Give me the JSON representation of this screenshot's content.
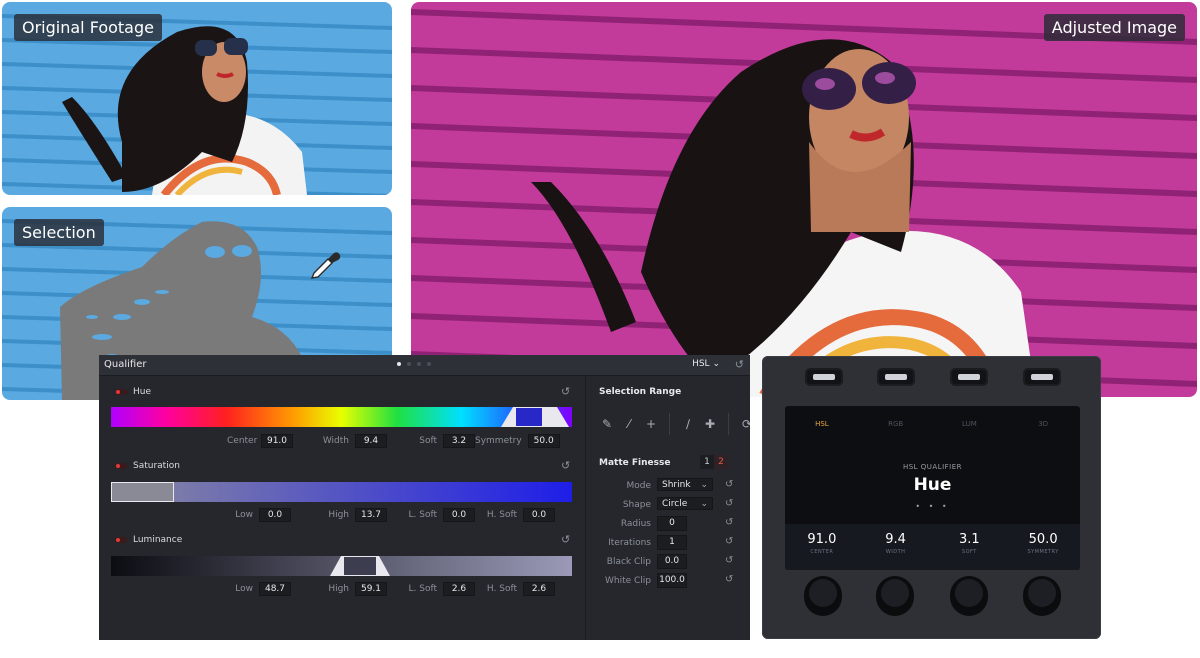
{
  "labels": {
    "original": "Original Footage",
    "selection": "Selection",
    "adjusted": "Adjusted Image"
  },
  "qualifier": {
    "title": "Qualifier",
    "mode": "HSL",
    "mode_chevron_icon": "chevron-down-icon",
    "hue": {
      "label": "Hue",
      "fields": [
        {
          "label": "Center",
          "value": "91.0"
        },
        {
          "label": "Width",
          "value": "9.4"
        },
        {
          "label": "Soft",
          "value": "3.2"
        },
        {
          "label": "Symmetry",
          "value": "50.0"
        }
      ]
    },
    "saturation": {
      "label": "Saturation",
      "fields": [
        {
          "label": "Low",
          "value": "0.0"
        },
        {
          "label": "High",
          "value": "13.7"
        },
        {
          "label": "L. Soft",
          "value": "0.0"
        },
        {
          "label": "H. Soft",
          "value": "0.0"
        }
      ]
    },
    "luminance": {
      "label": "Luminance",
      "fields": [
        {
          "label": "Low",
          "value": "48.7"
        },
        {
          "label": "High",
          "value": "59.1"
        },
        {
          "label": "L. Soft",
          "value": "2.6"
        },
        {
          "label": "H. Soft",
          "value": "2.6"
        }
      ]
    },
    "selection_range": {
      "title": "Selection Range",
      "tools": [
        "eyedropper-icon",
        "pen-icon",
        "pen-add-icon",
        "feather-icon",
        "feather-add-icon",
        "invert-icon"
      ]
    },
    "matte_finesse": {
      "title": "Matte Finesse",
      "pages": [
        "1",
        "2"
      ],
      "rows": [
        {
          "label": "Mode",
          "value": "Shrink",
          "type": "select"
        },
        {
          "label": "Shape",
          "value": "Circle",
          "type": "select"
        },
        {
          "label": "Radius",
          "value": "0",
          "type": "field"
        },
        {
          "label": "Iterations",
          "value": "1",
          "type": "field"
        },
        {
          "label": "Black Clip",
          "value": "0.0",
          "type": "field"
        },
        {
          "label": "White Clip",
          "value": "100.0",
          "type": "field"
        }
      ]
    }
  },
  "hardware": {
    "tabs": [
      "HSL",
      "RGB",
      "LUM",
      "3D"
    ],
    "active_tab": "HSL",
    "subtitle": "HSL QUALIFIER",
    "main": "Hue",
    "dots": "• • •",
    "values": [
      {
        "num": "91.0",
        "cap": "CENTER"
      },
      {
        "num": "9.4",
        "cap": "WIDTH"
      },
      {
        "num": "3.1",
        "cap": "SOFT"
      },
      {
        "num": "50.0",
        "cap": "SYMMETRY"
      }
    ]
  },
  "colors": {
    "wall_blue": "#5aa9e0",
    "wall_magenta": "#c23a9a",
    "panel_bg": "#25272d",
    "accent_orange": "#e8a53a",
    "led_red": "#e23b3b"
  }
}
